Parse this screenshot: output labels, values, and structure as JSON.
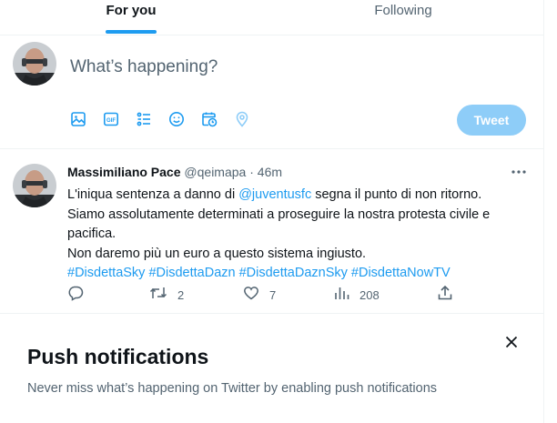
{
  "tabs": {
    "for_you": "For you",
    "following": "Following"
  },
  "composer": {
    "placeholder": "What’s happening?",
    "tools": [
      "image-icon",
      "gif-icon",
      "poll-icon",
      "emoji-icon",
      "schedule-icon",
      "location-icon"
    ],
    "tweet_button": "Tweet"
  },
  "tweet": {
    "author": "Massimiliano Pace",
    "handle": "@qeimapa",
    "separator": "·",
    "time": "46m",
    "text_before_mention": "L'iniqua sentenza a danno di ",
    "mention": "@juventusfc",
    "text_after_mention": " segna il punto di non ritorno.",
    "line2": "Siamo assolutamente determinati a proseguire la nostra protesta civile e pacifica.",
    "line3": "Non daremo più un euro a questo sistema ingiusto.",
    "hashtags": [
      "#DisdettaSky",
      "#DisdettaDazn",
      "#DisdettaDaznSky",
      "#DisdettaNowTV"
    ],
    "replies": "",
    "retweets": "2",
    "likes": "7",
    "views": "208"
  },
  "push": {
    "title": "Push notifications",
    "subtitle": "Never miss what’s happening on Twitter by enabling push notifications"
  },
  "colors": {
    "accent": "#1d9bf0",
    "button_disabled": "#8ecdf8",
    "muted": "#536471",
    "border": "#eff3f4"
  }
}
